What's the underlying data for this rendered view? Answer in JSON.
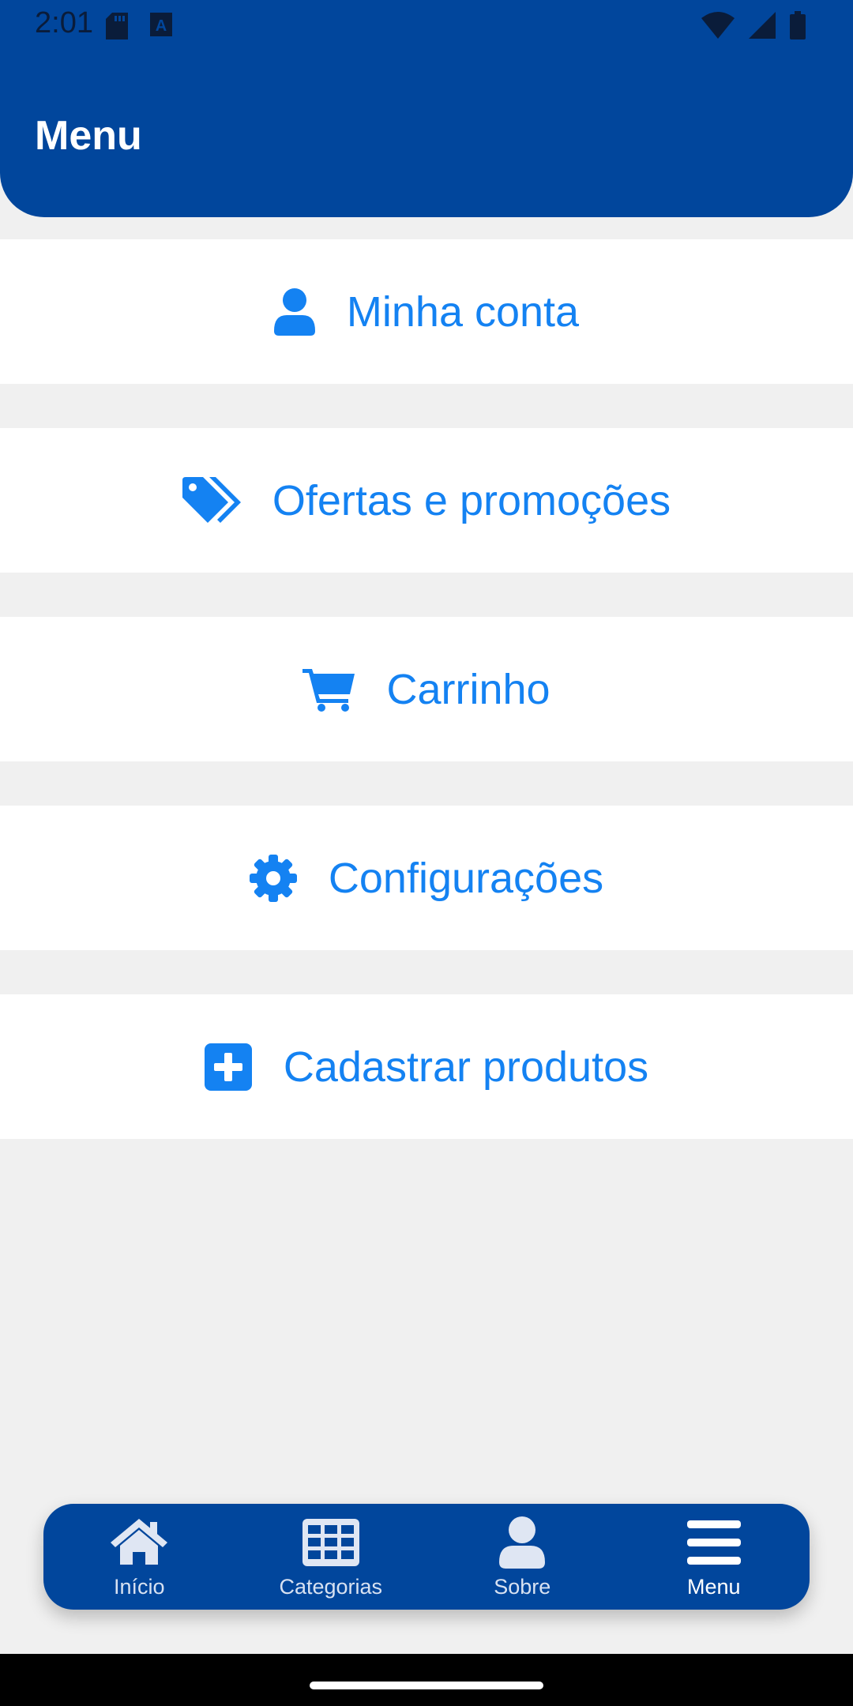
{
  "status_bar": {
    "time": "2:01",
    "left_icons": [
      "sd-card-icon",
      "keyboard-a-icon"
    ],
    "right_icons": [
      "wifi-icon",
      "signal-icon",
      "battery-icon"
    ]
  },
  "header": {
    "title": "Menu"
  },
  "menu": {
    "items": [
      {
        "label": "Minha conta",
        "icon": "user-icon"
      },
      {
        "label": "Ofertas e promoções",
        "icon": "tags-icon"
      },
      {
        "label": "Carrinho",
        "icon": "cart-icon"
      },
      {
        "label": "Configurações",
        "icon": "gear-icon"
      },
      {
        "label": "Cadastrar produtos",
        "icon": "plus-square-icon"
      }
    ]
  },
  "bottom_nav": {
    "items": [
      {
        "label": "Início",
        "icon": "home-icon"
      },
      {
        "label": "Categorias",
        "icon": "grid-icon"
      },
      {
        "label": "Sobre",
        "icon": "user-icon"
      },
      {
        "label": "Menu",
        "icon": "hamburger-icon",
        "active": true
      }
    ]
  },
  "colors": {
    "primary": "#01469c",
    "accent": "#1482f2",
    "background": "#f0f0f0",
    "nav_icon": "#dfe6f3"
  }
}
